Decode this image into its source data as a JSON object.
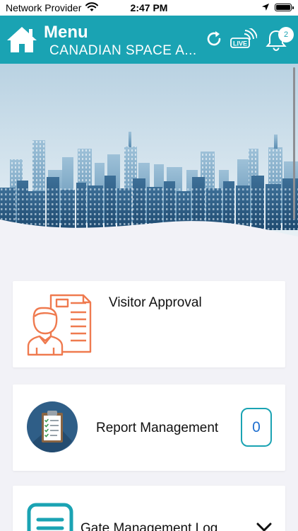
{
  "status_bar": {
    "carrier": "Network Provider",
    "time": "2:47 PM"
  },
  "header": {
    "title": "Menu",
    "subtitle": "CANADIAN SPACE A...",
    "live_label": "LIVE",
    "notification_count": "2",
    "icons": [
      "home-icon",
      "refresh-icon",
      "live-broadcast-icon",
      "bell-icon"
    ]
  },
  "menu": {
    "items": [
      {
        "label": "Visitor Approval",
        "icon": "visitor-document-icon"
      },
      {
        "label": "Report Management",
        "icon": "clipboard-checklist-icon",
        "count": "0"
      },
      {
        "label": "Gate Management Log",
        "icon": "list-icon",
        "expandable": true
      }
    ]
  },
  "colors": {
    "header": "#1aa3b3",
    "visitor_icon": "#ef7a4f",
    "report_icon_bg": "#2f5e87",
    "count_text": "#1f6fcf"
  }
}
